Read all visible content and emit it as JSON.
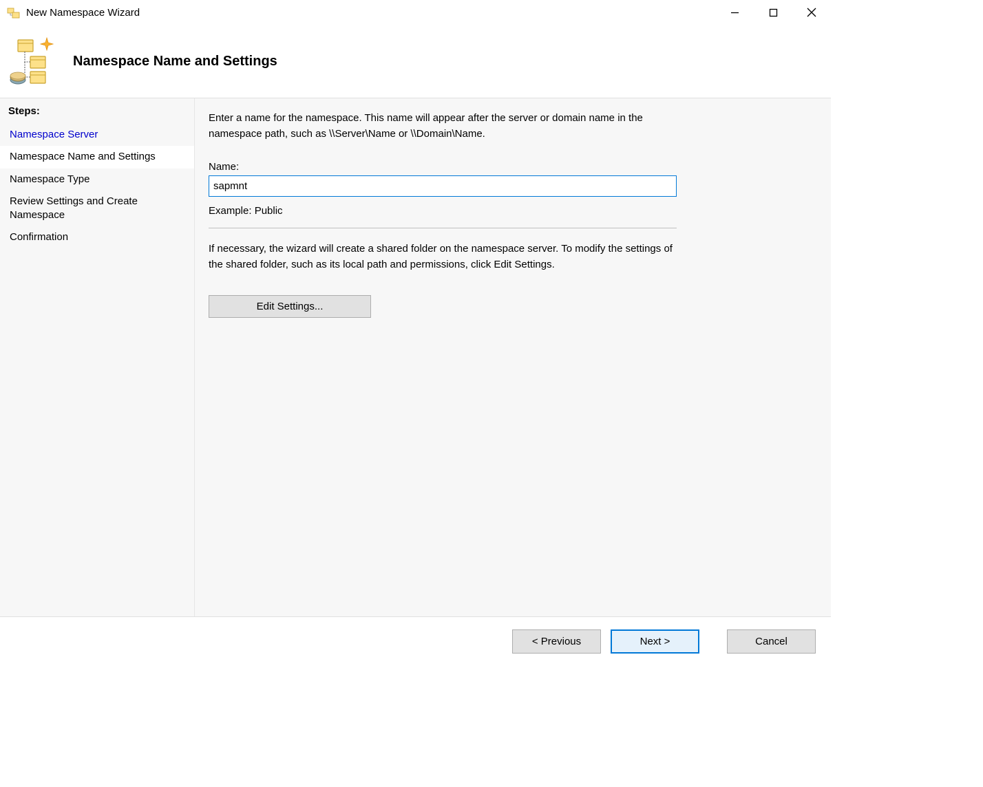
{
  "window": {
    "title": "New Namespace Wizard"
  },
  "header": {
    "title": "Namespace Name and Settings"
  },
  "steps": {
    "heading": "Steps:",
    "items": [
      "Namespace Server",
      "Namespace Name and Settings",
      "Namespace Type",
      "Review Settings and Create Namespace",
      "Confirmation"
    ]
  },
  "content": {
    "intro": "Enter a name for the namespace. This name will appear after the server or domain name in the namespace path, such as \\\\Server\\Name or \\\\Domain\\Name.",
    "name_label": "Name:",
    "name_value": "sapmnt",
    "example": "Example: Public",
    "secondary": "If necessary, the wizard will create a shared folder on the namespace server. To modify the settings of the shared folder, such as its local path and permissions, click Edit Settings.",
    "edit_button": "Edit Settings..."
  },
  "footer": {
    "previous": "< Previous",
    "next": "Next >",
    "cancel": "Cancel"
  }
}
